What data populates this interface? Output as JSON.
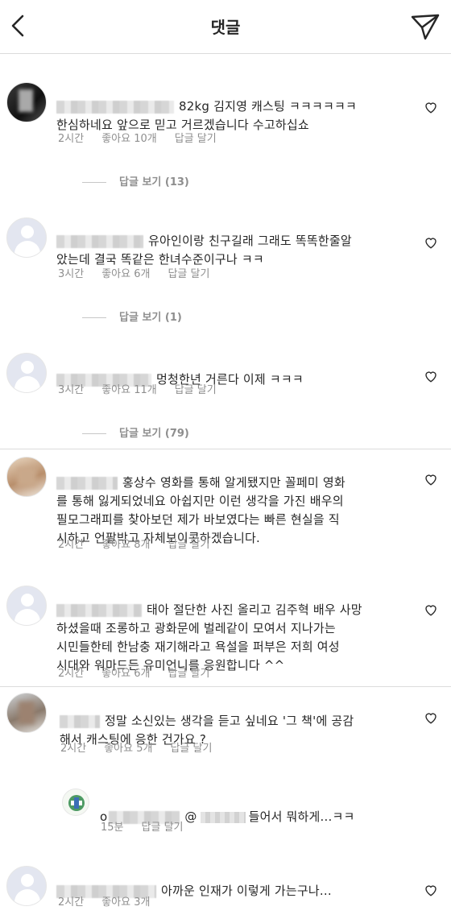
{
  "header": {
    "title": "댓글",
    "back_icon": "chevron-left-icon",
    "share_icon": "send-icon"
  },
  "labels": {
    "reply": "답글 달기"
  },
  "comments": [
    {
      "text": "82kg 김지영 캐스팅 ㅋㅋㅋㅋㅋㅋ\n한심하네요 앞으로 믿고 거르겠습니다 수고하십쇼",
      "time": "2시간",
      "likes": "좋아요 10개",
      "replies": "답글 보기 (13)"
    },
    {
      "text": "유아인이랑 친구길래 그래도 똑똑한줄알\n았는데 결국 똑같은 한녀수준이구나 ㅋㅋ",
      "time": "3시간",
      "likes": "좋아요 6개",
      "replies": "답글 보기 (1)"
    },
    {
      "text": "멍청한년 거른다 이제 ㅋㅋㅋ",
      "time": "3시간",
      "likes": "좋아요 11개",
      "replies": "답글 보기 (79)"
    },
    {
      "text": "홍상수 영화를 통해 알게됐지만 꼴페미 영화\n를 통해 잃게되었네요 아쉽지만 이런 생각을 가진 배우의\n필모그래피를 찾아보던 제가 바보였다는 빠른 현실을 직\n시하고 언팔박고 자체보이콧하겠습니다.",
      "time": "2시간",
      "likes": "좋아요 8개"
    },
    {
      "text": "태아 절단한 사진 올리고 김주혁 배우 사망\n하셨을때 조롱하고 광화문에 벌레같이 모여서 지나가는\n시민들한테 한남충 재기해라고 욕설을 퍼부은 저희 여성\n시대와 워마드든 유미언니를 응원합니다 ^^",
      "time": "2시간",
      "likes": "좋아요 6개"
    },
    {
      "text": "정말 소신있는 생각을 듣고 싶네요 '그 책'에 공감\n해서 캐스팅에 응한 건가요 ?",
      "time": "2시간",
      "likes": "좋아요 5개"
    },
    {
      "user_initial": "o",
      "at": "@",
      "text": "들어서 뭐하게...ㅋㅋ",
      "time": "15분"
    },
    {
      "text": "아까운 인재가 이렇게 가는구나...",
      "time": "2시간",
      "likes": "좋아요 3개"
    }
  ]
}
